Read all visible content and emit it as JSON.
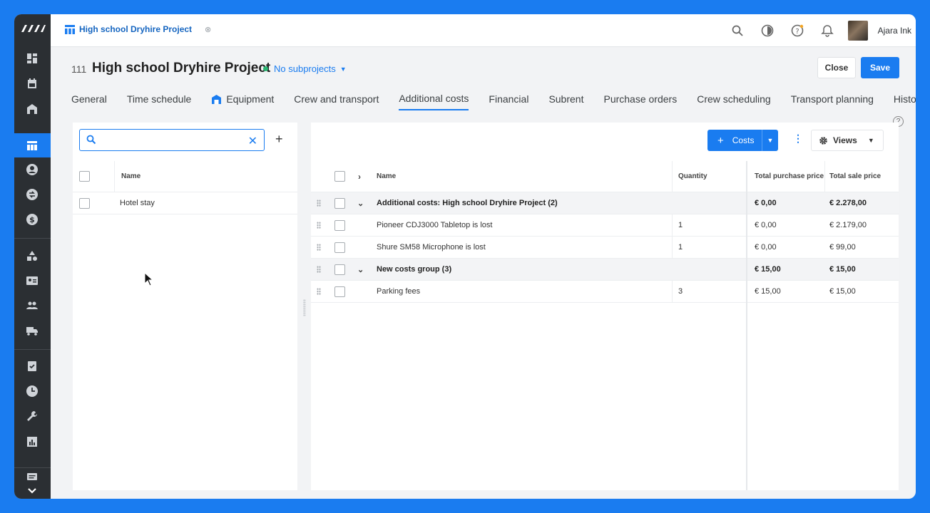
{
  "colors": {
    "accent": "#1a7cf0",
    "rail": "#2b2f33",
    "status_dot": "#2bb673"
  },
  "rail": {
    "icons": [
      "dashboard-icon",
      "calendar-icon",
      "warehouse-icon",
      "projects-icon",
      "contacts-icon",
      "exchange-icon",
      "finance-icon",
      "shapes-icon",
      "crew-card-icon",
      "people-icon",
      "truck-icon",
      "tasks-icon",
      "clock-icon",
      "wrench-icon",
      "reports-icon",
      "chat-icon",
      "chevron-down-icon"
    ]
  },
  "topbar": {
    "open_tab": "High school Dryhire Project",
    "user_name": "Ajara Ink"
  },
  "header": {
    "project_number": "111",
    "project_title": "High school Dryhire Project",
    "subprojects": "No subprojects",
    "close_label": "Close",
    "save_label": "Save"
  },
  "tabs": [
    {
      "label": "General"
    },
    {
      "label": "Time schedule"
    },
    {
      "label": "Equipment"
    },
    {
      "label": "Crew and transport"
    },
    {
      "label": "Additional costs"
    },
    {
      "label": "Financial"
    },
    {
      "label": "Subrent"
    },
    {
      "label": "Purchase orders"
    },
    {
      "label": "Crew scheduling"
    },
    {
      "label": "Transport planning"
    },
    {
      "label": "Histor"
    }
  ],
  "left": {
    "search_value": "",
    "column_name": "Name",
    "rows": [
      {
        "name": "Hotel stay"
      }
    ]
  },
  "right": {
    "costs_button": "Costs",
    "views_button": "Views",
    "columns": {
      "name": "Name",
      "quantity": "Quantity",
      "total_purchase": "Total purchase price",
      "total_sale": "Total sale price"
    },
    "rows": [
      {
        "group": true,
        "name": "Additional costs: High school Dryhire Project (2)",
        "quantity": "",
        "purchase": "€ 0,00",
        "sale": "€ 2.278,00"
      },
      {
        "group": false,
        "name": "Pioneer CDJ3000 Tabletop is lost",
        "quantity": "1",
        "purchase": "€ 0,00",
        "sale": "€ 2.179,00"
      },
      {
        "group": false,
        "name": "Shure SM58 Microphone is lost",
        "quantity": "1",
        "purchase": "€ 0,00",
        "sale": "€ 99,00"
      },
      {
        "group": true,
        "name": "New costs group (3)",
        "quantity": "",
        "purchase": "€ 15,00",
        "sale": "€ 15,00"
      },
      {
        "group": false,
        "name": "Parking fees",
        "quantity": "3",
        "purchase": "€ 15,00",
        "sale": "€ 15,00"
      }
    ]
  }
}
